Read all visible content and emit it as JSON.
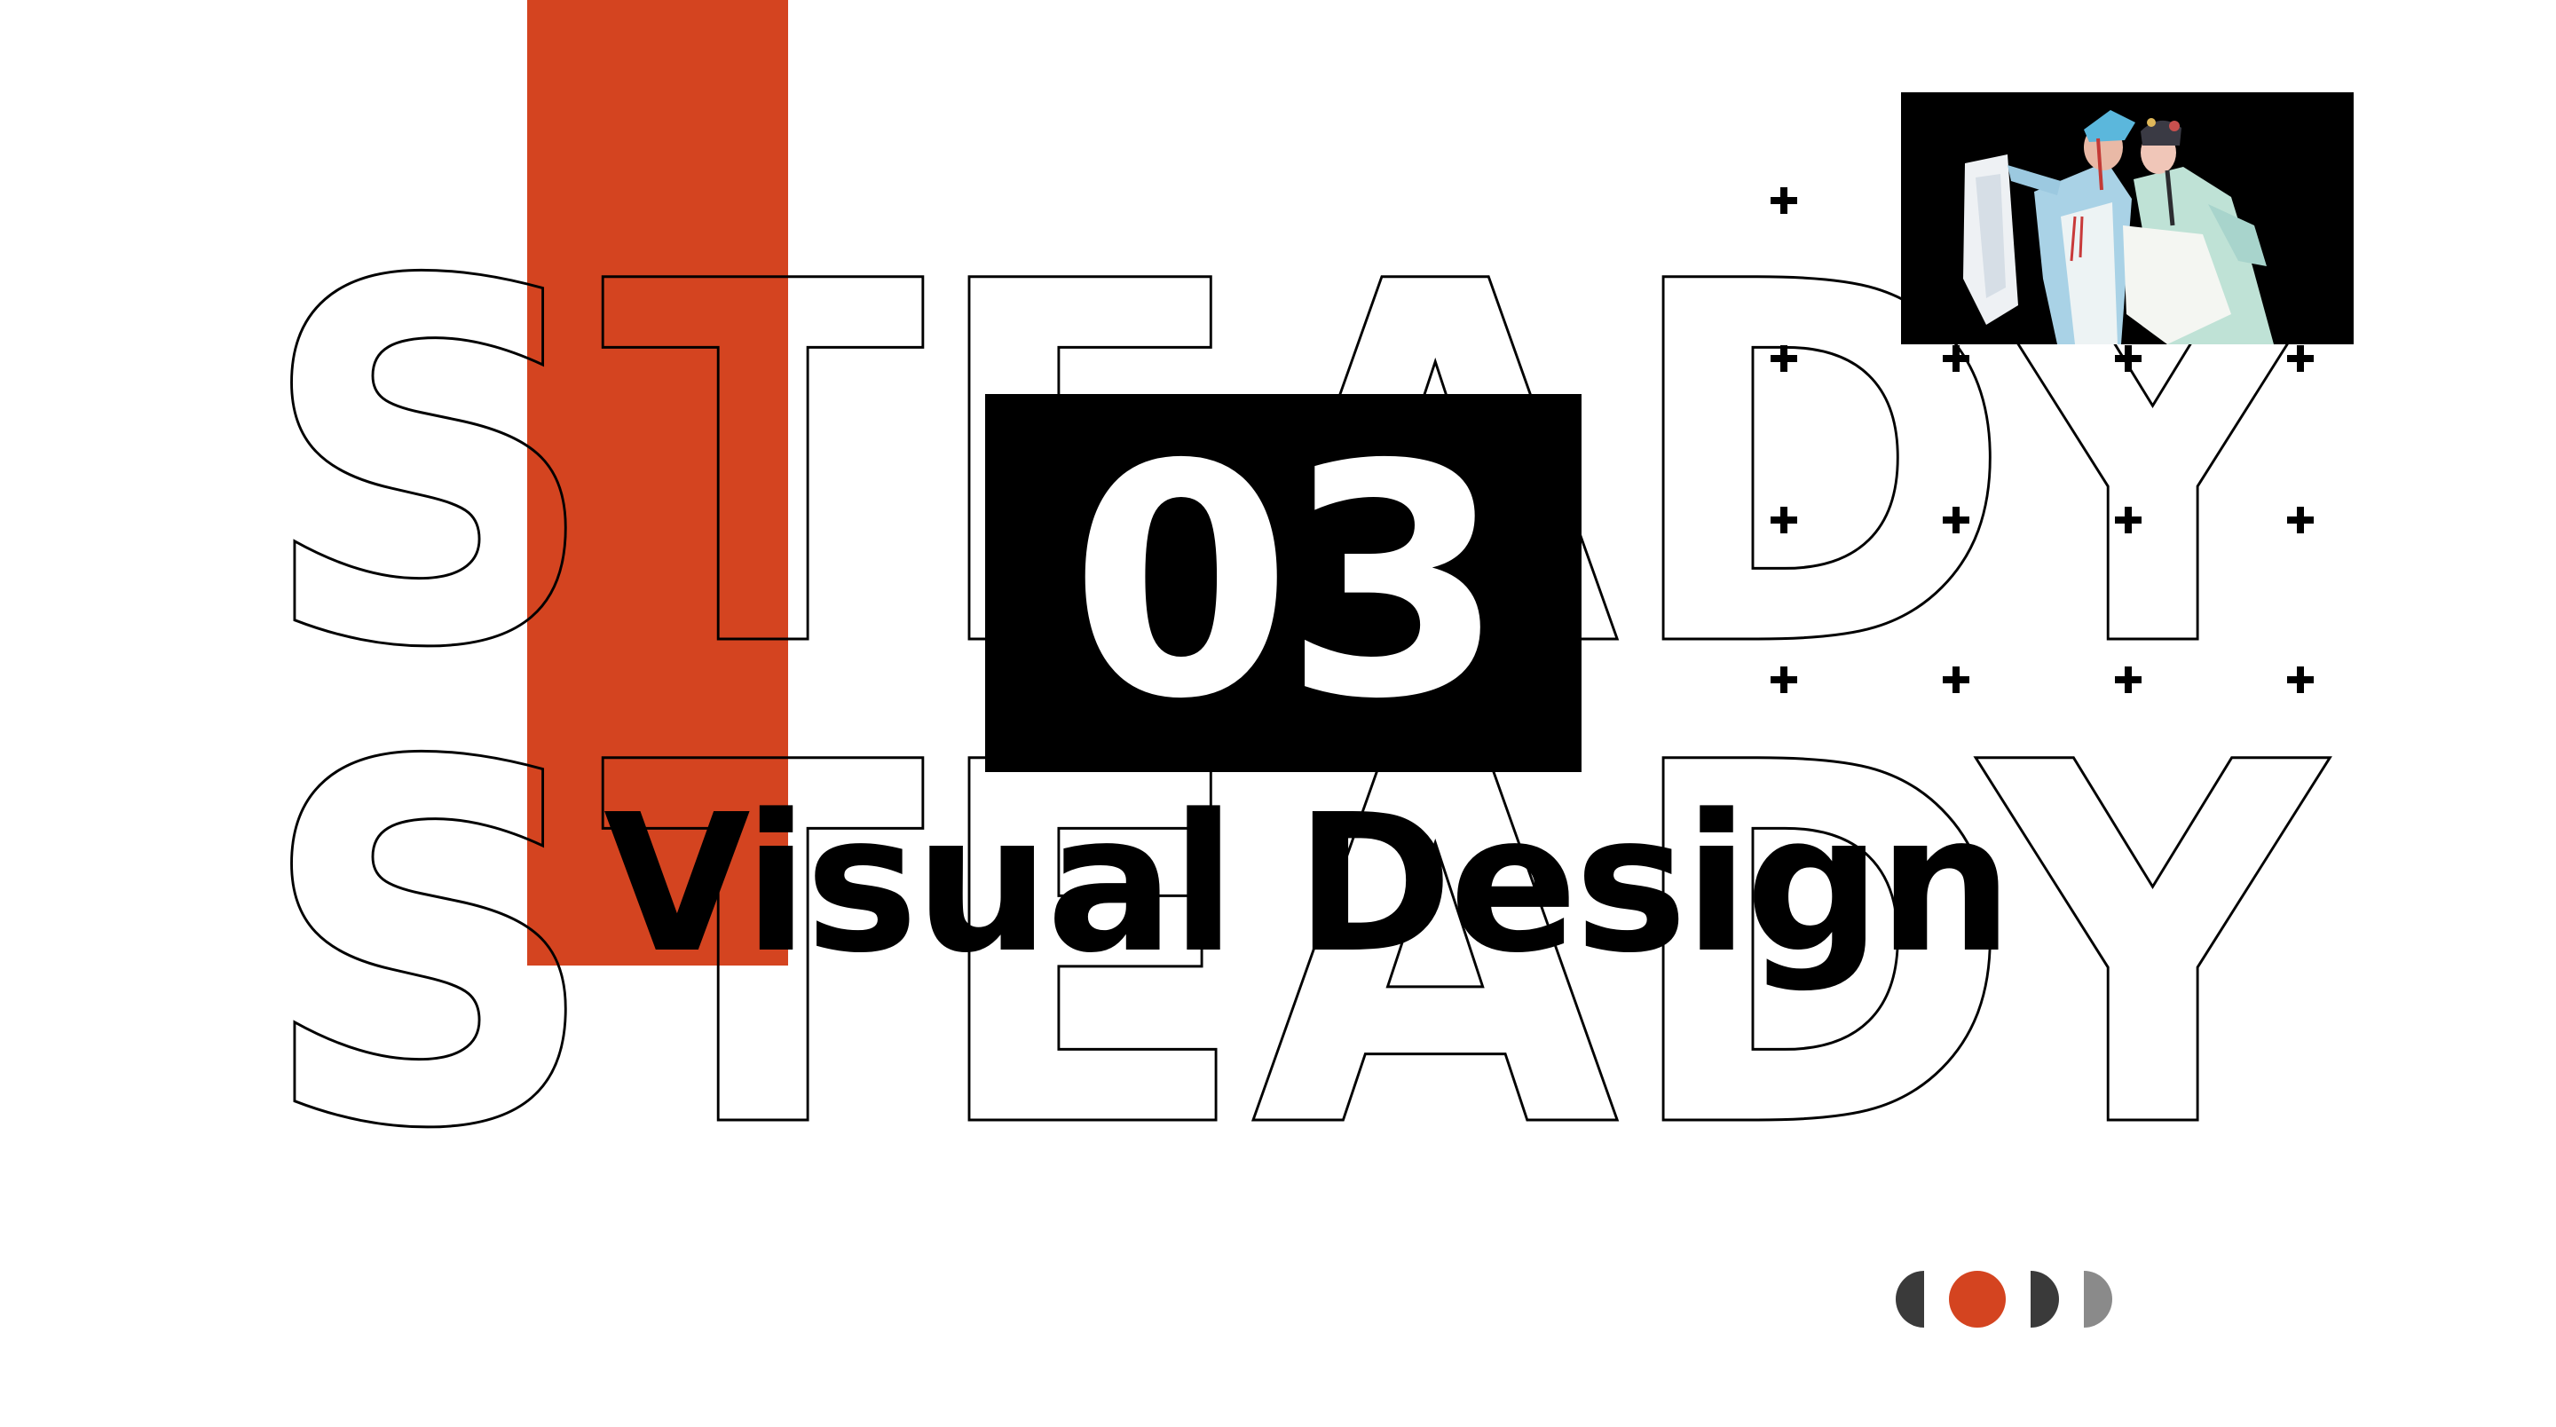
{
  "slide": {
    "background_word": "STEADY",
    "section_number": "03",
    "section_title": "Visual Design"
  },
  "colors": {
    "accent": "#D44420",
    "ink": "#000000",
    "background": "#FFFFFF",
    "pager_dark": "#3A3A3A",
    "pager_gray": "#8A8A8A"
  },
  "photo": {
    "icon": "opera-performers-photo"
  },
  "pager": {
    "total": 4,
    "current": 2
  }
}
